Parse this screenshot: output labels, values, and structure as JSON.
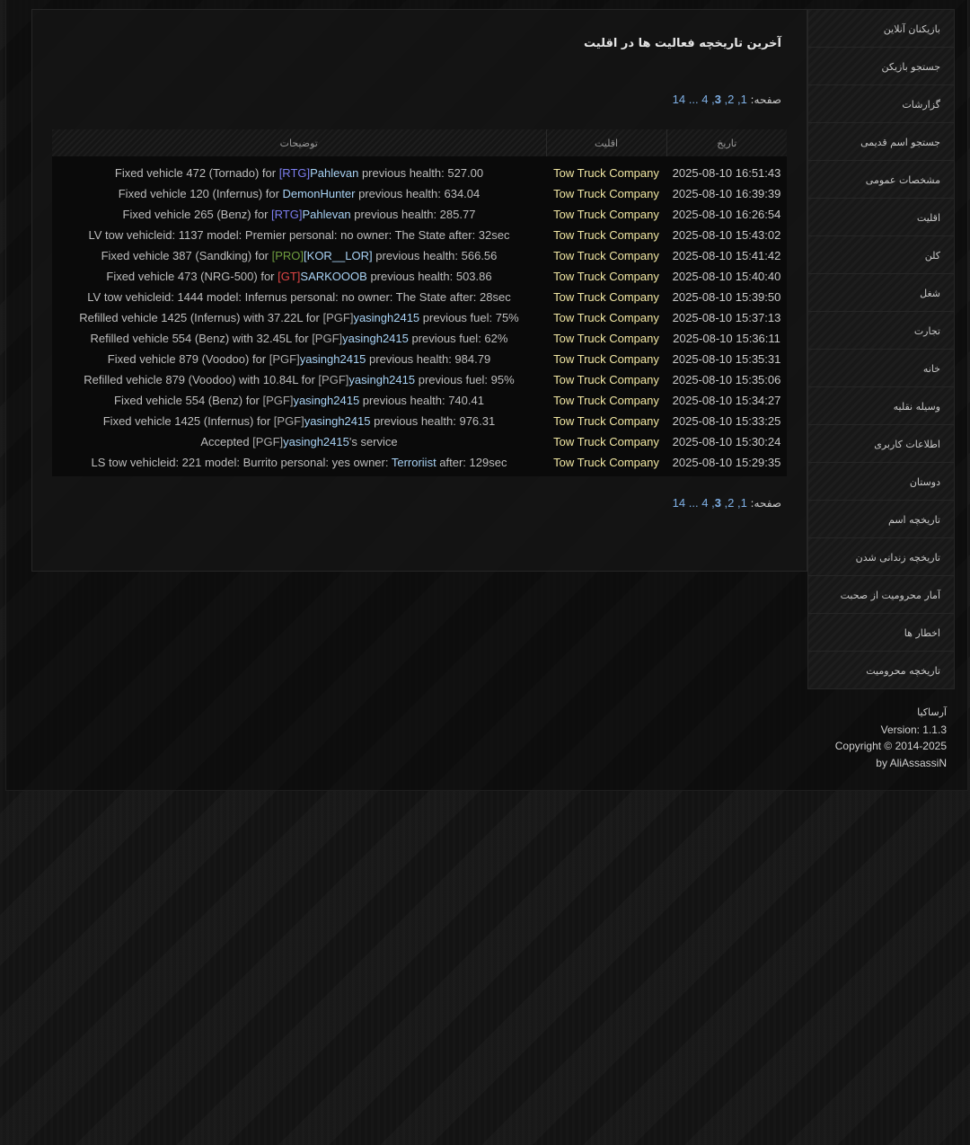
{
  "page_title": "آخرین تاریخچه فعالیت ها در اقلیت",
  "pagination": {
    "label": "صفحه:",
    "pages": [
      "1",
      "2",
      "3",
      "4"
    ],
    "current": "3",
    "ellipsis": "...",
    "last": "14"
  },
  "table": {
    "headers": {
      "date": "تاریخ",
      "faction": "اقلیت",
      "description": "توضیحات"
    },
    "rows": [
      {
        "date": "2025-08-10 16:51:43",
        "faction": "Tow Truck Company",
        "desc": {
          "pre": "Fixed vehicle 472 (Tornado) for ",
          "tag": "[RTG]",
          "player": "Pahlevan",
          "post": " previous health: 527.00"
        }
      },
      {
        "date": "2025-08-10 16:39:39",
        "faction": "Tow Truck Company",
        "desc": {
          "pre": "Fixed vehicle 120 (Infernus) for ",
          "tag": "",
          "player": "DemonHunter",
          "post": " previous health: 634.04"
        }
      },
      {
        "date": "2025-08-10 16:26:54",
        "faction": "Tow Truck Company",
        "desc": {
          "pre": "Fixed vehicle 265 (Benz) for ",
          "tag": "[RTG]",
          "player": "Pahlevan",
          "post": " previous health: 285.77"
        }
      },
      {
        "date": "2025-08-10 15:43:02",
        "faction": "Tow Truck Company",
        "desc": {
          "pre": "LV tow vehicleid: 1137 model: Premier personal: no owner: The State after: 32sec",
          "tag": "",
          "player": "",
          "post": ""
        }
      },
      {
        "date": "2025-08-10 15:41:42",
        "faction": "Tow Truck Company",
        "desc": {
          "pre": "Fixed vehicle 387 (Sandking) for ",
          "tag": "[PRO]",
          "player": "[KOR__LOR]",
          "post": " previous health: 566.56"
        }
      },
      {
        "date": "2025-08-10 15:40:40",
        "faction": "Tow Truck Company",
        "desc": {
          "pre": "Fixed vehicle 473 (NRG-500) for ",
          "tag": "[GT]",
          "player": "SARKOOOB",
          "post": " previous health: 503.86"
        }
      },
      {
        "date": "2025-08-10 15:39:50",
        "faction": "Tow Truck Company",
        "desc": {
          "pre": "LV tow vehicleid: 1444 model: Infernus personal: no owner: The State after: 28sec",
          "tag": "",
          "player": "",
          "post": ""
        }
      },
      {
        "date": "2025-08-10 15:37:13",
        "faction": "Tow Truck Company",
        "desc": {
          "pre": "Refilled vehicle 1425 (Infernus) with 37.22L for ",
          "tag": "[PGF]",
          "player": "yasingh2415",
          "post": " previous fuel: 75%"
        }
      },
      {
        "date": "2025-08-10 15:36:11",
        "faction": "Tow Truck Company",
        "desc": {
          "pre": "Refilled vehicle 554 (Benz) with 32.45L for ",
          "tag": "[PGF]",
          "player": "yasingh2415",
          "post": " previous fuel: 62%"
        }
      },
      {
        "date": "2025-08-10 15:35:31",
        "faction": "Tow Truck Company",
        "desc": {
          "pre": "Fixed vehicle 879 (Voodoo) for ",
          "tag": "[PGF]",
          "player": "yasingh2415",
          "post": " previous health: 984.79"
        }
      },
      {
        "date": "2025-08-10 15:35:06",
        "faction": "Tow Truck Company",
        "desc": {
          "pre": "Refilled vehicle 879 (Voodoo) with 10.84L for ",
          "tag": "[PGF]",
          "player": "yasingh2415",
          "post": " previous fuel: 95%"
        }
      },
      {
        "date": "2025-08-10 15:34:27",
        "faction": "Tow Truck Company",
        "desc": {
          "pre": "Fixed vehicle 554 (Benz) for ",
          "tag": "[PGF]",
          "player": "yasingh2415",
          "post": " previous health: 740.41"
        }
      },
      {
        "date": "2025-08-10 15:33:25",
        "faction": "Tow Truck Company",
        "desc": {
          "pre": "Fixed vehicle 1425 (Infernus) for ",
          "tag": "[PGF]",
          "player": "yasingh2415",
          "post": " previous health: 976.31"
        }
      },
      {
        "date": "2025-08-10 15:30:24",
        "faction": "Tow Truck Company",
        "desc": {
          "pre": "Accepted ",
          "tag": "[PGF]",
          "player": "yasingh2415",
          "post": "'s service"
        }
      },
      {
        "date": "2025-08-10 15:29:35",
        "faction": "Tow Truck Company",
        "desc": {
          "pre": "LS tow vehicleid: 221 model: Burrito personal: yes owner: ",
          "tag": "",
          "player": "Terroriist",
          "post": " after: 129sec"
        }
      }
    ]
  },
  "sidebar": {
    "items": [
      "بازیکنان آنلاین",
      "جستجو بازیکن",
      "گزارشات",
      "جستجو اسم قدیمی",
      "مشخصات عمومی",
      "اقلیت",
      "کلن",
      "شغل",
      "تجارت",
      "خانه",
      "وسیله نقلیه",
      "اطلاعات کاربری",
      "دوستان",
      "تاریخچه اسم",
      "تاریخچه زندانی شدن",
      "آمار محرومیت از صحبت",
      "اخطار ها",
      "تاریخچه محرومیت"
    ]
  },
  "footer": {
    "brand": "آرساکیا",
    "version": "Version: 1.1.3",
    "copyright": "Copyright © 2014-2025",
    "author": "by AliAssassiN"
  },
  "colors": {
    "faction": "#f1e7a3",
    "player": "#a9d3f5",
    "tag_rtg": "#7d7ff0",
    "tag_pro": "#6f9d3f",
    "tag_gt": "#e04545",
    "link": "#7fb0e6"
  }
}
